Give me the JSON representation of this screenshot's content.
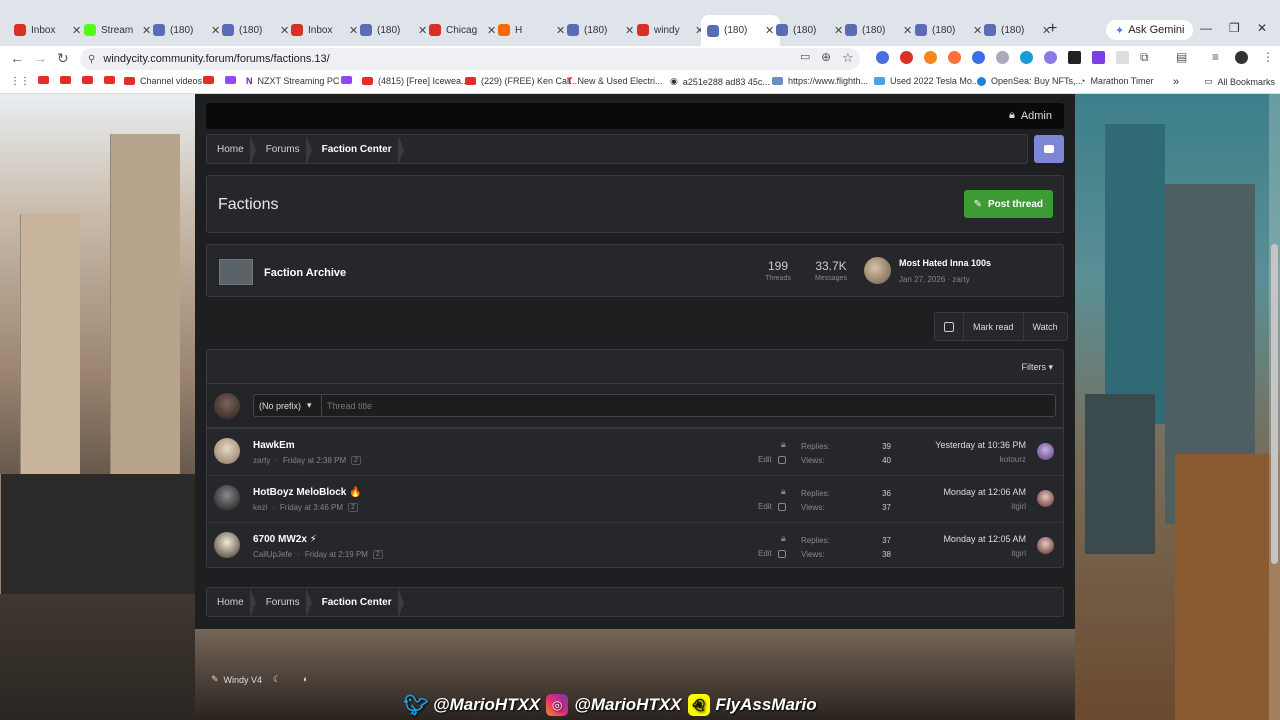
{
  "browser": {
    "tabs": [
      {
        "label": "Inbox",
        "color": "#d93025"
      },
      {
        "label": "Stream",
        "color": "#53fc18"
      },
      {
        "label": "(180)",
        "color": "#5b6bb5"
      },
      {
        "label": "(180)",
        "color": "#5b6bb5"
      },
      {
        "label": "Inbox",
        "color": "#d93025"
      },
      {
        "label": "(180)",
        "color": "#5b6bb5"
      },
      {
        "label": "Chicag",
        "color": "#d93025"
      },
      {
        "label": "H",
        "color": "#ff6a00"
      },
      {
        "label": "(180)",
        "color": "#5b6bb5"
      },
      {
        "label": "windy",
        "color": "#d93025"
      },
      {
        "label": "(180)",
        "color": "#5b6bb5"
      },
      {
        "label": "(180)",
        "color": "#5b6bb5"
      },
      {
        "label": "(180)",
        "color": "#5b6bb5"
      },
      {
        "label": "(180)",
        "color": "#5b6bb5"
      },
      {
        "label": "(180)",
        "color": "#5b6bb5"
      }
    ],
    "gemini": "Ask Gemini",
    "url": "windycity.community.forum/forums/factions.13/",
    "bookmarks": [
      "Channel videos",
      "NZXT Streaming PC",
      "(4815) [Free] Icewea...",
      "(229) (FREE) Ken Car...",
      "New & Used Electri...",
      "a251e288 ad83 45c...",
      "https://www.flighth...",
      "Used 2022 Tesla Mo...",
      "OpenSea: Buy NFTs,...",
      "Marathon Timer",
      "All Bookmarks"
    ]
  },
  "topnav": {
    "admin": "Admin"
  },
  "breadcrumb": [
    "Home",
    "Forums",
    "Faction Center"
  ],
  "page_title": "Factions",
  "post_thread": "Post thread",
  "subforum": {
    "title": "Faction Archive",
    "threads_num": "199",
    "threads_lbl": "Threads",
    "messages_num": "33.7K",
    "messages_lbl": "Messages",
    "last_title": "Most Hated Inna 100s",
    "last_meta": "Jan 27, 2026 · zarty"
  },
  "actions": {
    "mark_read": "Mark read",
    "watch": "Watch"
  },
  "filters": "Filters",
  "new_thread": {
    "prefix": "(No prefix)",
    "placeholder": "Thread title"
  },
  "labels": {
    "replies": "Replies:",
    "views": "Views:",
    "edit": "Edit"
  },
  "threads": [
    {
      "title": "HawkEm",
      "author": "zarty",
      "date": "Friday at 2:38 PM",
      "pages": "2",
      "replies": "39",
      "views": "40",
      "last_date": "Yesterday at 10:36 PM",
      "last_user": "kotourz",
      "emoji": ""
    },
    {
      "title": "HotBoyz MeloBlock",
      "author": "kezi",
      "date": "Friday at 3:46 PM",
      "pages": "2",
      "replies": "36",
      "views": "37",
      "last_date": "Monday at 12:06 AM",
      "last_user": "itgirl",
      "emoji": "🔥"
    },
    {
      "title": "6700 MW2x",
      "author": "CallUpJefe",
      "date": "Friday at 2:19 PM",
      "pages": "2",
      "replies": "37",
      "views": "38",
      "last_date": "Monday at 12:05 AM",
      "last_user": "itgirl",
      "emoji": "⚡"
    }
  ],
  "footer": {
    "style": "Windy V4"
  },
  "social": [
    "@MarioHTXX",
    "@MarioHTXX",
    "FlyAssMario"
  ],
  "colors": {
    "accent_green": "#3d9b35",
    "discord": "#7d87d6",
    "panel": "#26272a"
  }
}
